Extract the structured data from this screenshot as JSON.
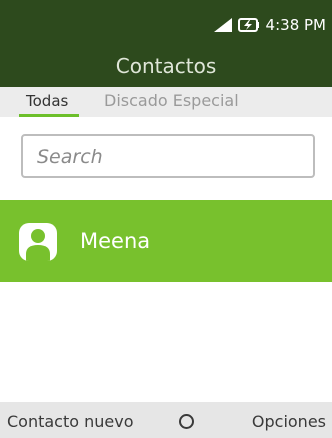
{
  "status": {
    "time": "4:38 PM",
    "icons": [
      "signal-icon",
      "battery-charging-icon"
    ]
  },
  "header": {
    "title": "Contactos"
  },
  "tabs": [
    {
      "label": "Todas",
      "active": true
    },
    {
      "label": "Discado Especial",
      "active": false
    }
  ],
  "search": {
    "placeholder": "Search"
  },
  "contacts": [
    {
      "name": "Meena",
      "icon": "person-icon"
    }
  ],
  "softkeys": {
    "left": "Contacto nuevo",
    "center_icon": "center-select-icon",
    "right": "Opciones"
  },
  "colors": {
    "header_bg": "#2d4a1d",
    "accent": "#78c12d",
    "tab_underline": "#6cbf2a",
    "softkey_bg": "#e6e6e6"
  }
}
